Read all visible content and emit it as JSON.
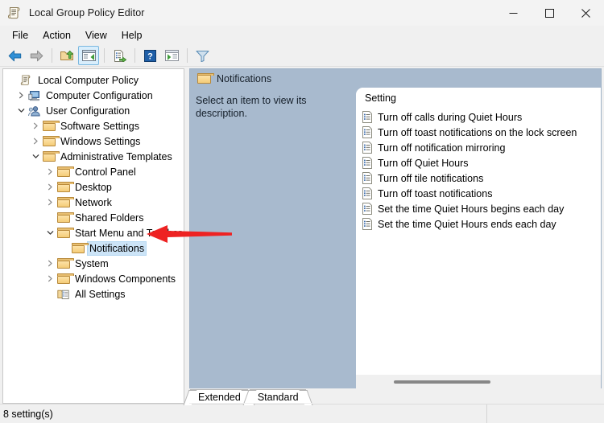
{
  "window": {
    "title": "Local Group Policy Editor",
    "icon": "console-scroll-icon",
    "controls": {
      "minimize": "minimize-icon",
      "maximize": "maximize-icon",
      "close": "close-icon"
    }
  },
  "menubar": {
    "items": [
      {
        "label": "File"
      },
      {
        "label": "Action"
      },
      {
        "label": "View"
      },
      {
        "label": "Help"
      }
    ]
  },
  "toolbar": {
    "buttons": [
      {
        "name": "back-arrow-icon",
        "kind": "back",
        "enabled": true
      },
      {
        "name": "forward-arrow-icon",
        "kind": "forward",
        "enabled": false
      },
      {
        "name": "separator"
      },
      {
        "name": "up-one-level-icon",
        "kind": "up"
      },
      {
        "name": "show-hide-console-tree-icon",
        "kind": "tree",
        "active": true
      },
      {
        "name": "separator"
      },
      {
        "name": "export-list-icon",
        "kind": "export"
      },
      {
        "name": "separator"
      },
      {
        "name": "help-icon",
        "kind": "help"
      },
      {
        "name": "properties-icon",
        "kind": "properties"
      },
      {
        "name": "separator"
      },
      {
        "name": "filter-icon",
        "kind": "filter"
      }
    ]
  },
  "tree": {
    "items": [
      {
        "label": "Local Computer Policy",
        "depth": 0,
        "icon": "console-scroll-icon",
        "twist": "none",
        "selected": false
      },
      {
        "label": "Computer Configuration",
        "depth": 1,
        "icon": "computer-icon",
        "twist": "collapsed",
        "selected": false
      },
      {
        "label": "User Configuration",
        "depth": 1,
        "icon": "user-icon",
        "twist": "expanded",
        "selected": false
      },
      {
        "label": "Software Settings",
        "depth": 2,
        "icon": "folder-icon",
        "twist": "collapsed",
        "selected": false
      },
      {
        "label": "Windows Settings",
        "depth": 2,
        "icon": "folder-icon",
        "twist": "collapsed",
        "selected": false
      },
      {
        "label": "Administrative Templates",
        "depth": 2,
        "icon": "folder-icon",
        "twist": "expanded",
        "selected": false
      },
      {
        "label": "Control Panel",
        "depth": 3,
        "icon": "folder-icon",
        "twist": "collapsed",
        "selected": false
      },
      {
        "label": "Desktop",
        "depth": 3,
        "icon": "folder-icon",
        "twist": "collapsed",
        "selected": false
      },
      {
        "label": "Network",
        "depth": 3,
        "icon": "folder-icon",
        "twist": "collapsed",
        "selected": false
      },
      {
        "label": "Shared Folders",
        "depth": 3,
        "icon": "folder-icon",
        "twist": "none",
        "selected": false
      },
      {
        "label": "Start Menu and Taskbar",
        "depth": 3,
        "icon": "folder-icon",
        "twist": "expanded",
        "selected": false
      },
      {
        "label": "Notifications",
        "depth": 4,
        "icon": "folder-icon",
        "twist": "none",
        "selected": true
      },
      {
        "label": "System",
        "depth": 3,
        "icon": "folder-icon",
        "twist": "collapsed",
        "selected": false
      },
      {
        "label": "Windows Components",
        "depth": 3,
        "icon": "folder-icon",
        "twist": "collapsed",
        "selected": false
      },
      {
        "label": "All Settings",
        "depth": 3,
        "icon": "all-settings-icon",
        "twist": "none",
        "selected": false
      }
    ]
  },
  "right_pane": {
    "header": {
      "title": "Notifications",
      "icon": "folder-icon"
    },
    "description": "Select an item to view its description.",
    "list": {
      "column_header": "Setting",
      "rows": [
        {
          "label": "Turn off calls during Quiet Hours",
          "icon": "policy-setting-icon"
        },
        {
          "label": "Turn off toast notifications on the lock screen",
          "icon": "policy-setting-icon"
        },
        {
          "label": "Turn off notification mirroring",
          "icon": "policy-setting-icon"
        },
        {
          "label": "Turn off Quiet Hours",
          "icon": "policy-setting-icon"
        },
        {
          "label": "Turn off tile notifications",
          "icon": "policy-setting-icon"
        },
        {
          "label": "Turn off toast notifications",
          "icon": "policy-setting-icon"
        },
        {
          "label": "Set the time Quiet Hours begins each day",
          "icon": "policy-setting-icon"
        },
        {
          "label": "Set the time Quiet Hours ends each day",
          "icon": "policy-setting-icon"
        }
      ]
    },
    "tabs": [
      {
        "label": "Extended",
        "active": false
      },
      {
        "label": "Standard",
        "active": true
      }
    ]
  },
  "statusbar": {
    "text": "8 setting(s)"
  },
  "annotation": {
    "arrow": "red-left-arrow",
    "color": "#ee2222"
  },
  "colors": {
    "header_blue": "#a8bace",
    "selection": "#cce4f7",
    "chrome": "#f0f0f0",
    "annotation_red": "#ee2222"
  }
}
